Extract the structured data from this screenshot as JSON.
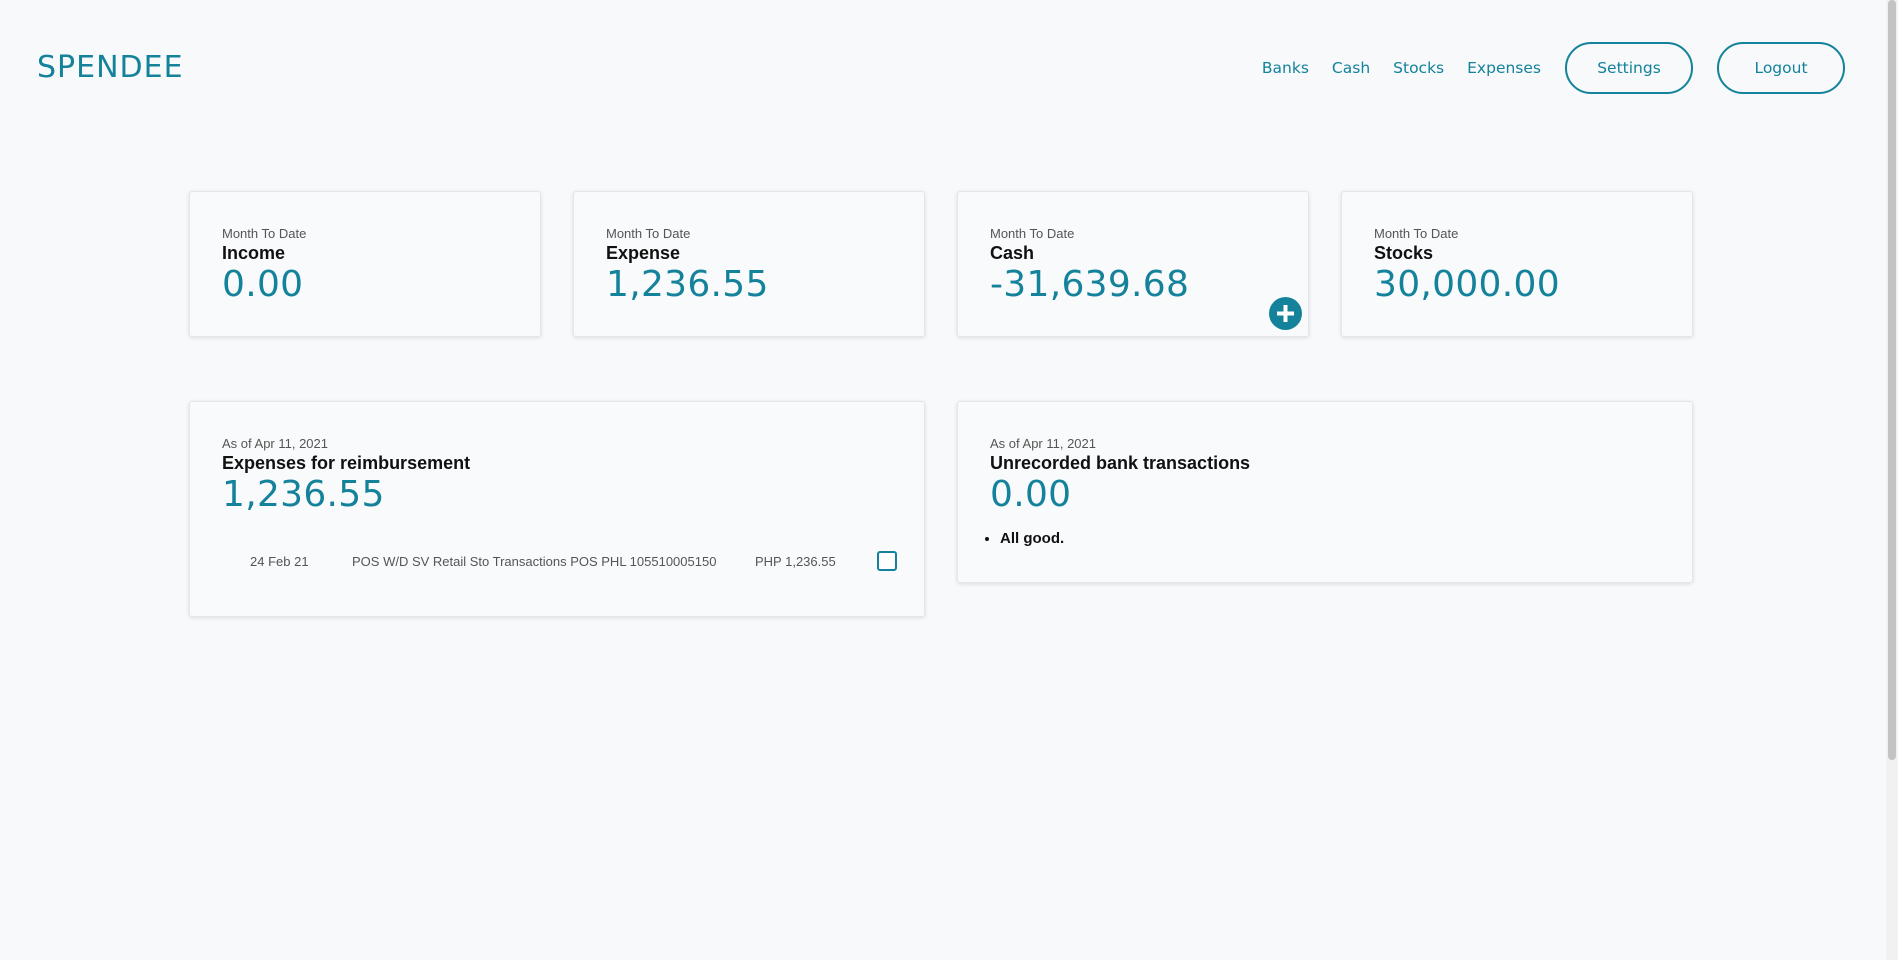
{
  "app": {
    "logo": "SPENDEE"
  },
  "nav": {
    "links": [
      "Banks",
      "Cash",
      "Stocks",
      "Expenses"
    ],
    "settings_label": "Settings",
    "logout_label": "Logout"
  },
  "summary_cards": [
    {
      "caption": "Month To Date",
      "title": "Income",
      "value": "0.00"
    },
    {
      "caption": "Month To Date",
      "title": "Expense",
      "value": "1,236.55"
    },
    {
      "caption": "Month To Date",
      "title": "Cash",
      "value": "-31,639.68",
      "action_icon": "plus-circle-icon"
    },
    {
      "caption": "Month To Date",
      "title": "Stocks",
      "value": "30,000.00"
    }
  ],
  "reimbursement": {
    "caption": "As of Apr 11, 2021",
    "title": "Expenses for reimbursement",
    "value": "1,236.55",
    "rows": [
      {
        "date": "24 Feb 21",
        "description": "POS W/D SV Retail Sto Transactions POS PHL 105510005150",
        "amount": "PHP 1,236.55",
        "checked": false
      }
    ]
  },
  "unrecorded": {
    "caption": "As of Apr 11, 2021",
    "title": "Unrecorded bank transactions",
    "value": "0.00",
    "notes": [
      "All good."
    ]
  },
  "colors": {
    "accent": "#13829a",
    "background": "#f7f9fb"
  }
}
